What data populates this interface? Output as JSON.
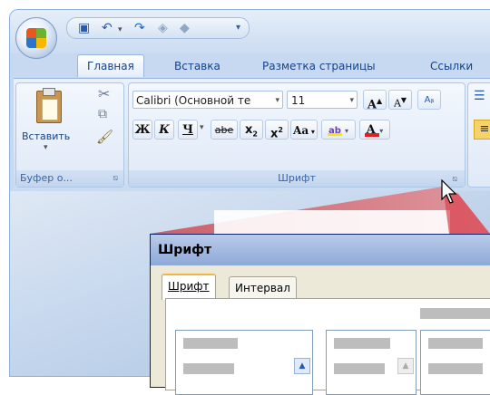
{
  "quick_access": {
    "save_icon": "save-icon",
    "undo_icon": "undo-icon",
    "redo_icon": "redo-icon"
  },
  "tabs": [
    "Главная",
    "Вставка",
    "Разметка страницы",
    "Ссылки"
  ],
  "clipboard_group": {
    "paste_label": "Вставить",
    "group_label": "Буфер о..."
  },
  "font_group": {
    "font_name": "Calibri (Основной те",
    "font_size": "11",
    "bold": "Ж",
    "italic": "К",
    "underline": "Ч",
    "strike": "abe",
    "subscript": "x",
    "superscript": "x",
    "change_case": "Aa",
    "font_color": "A",
    "grow": "A",
    "shrink": "A",
    "group_label": "Шрифт"
  },
  "dialog": {
    "title": "Шрифт",
    "tabs": [
      "Шрифт",
      "Интервал"
    ]
  },
  "colors": {
    "accent": "#15428b",
    "highlight": "#ffe600",
    "font_color_red": "#e02020",
    "wedge": "#d8414f"
  }
}
